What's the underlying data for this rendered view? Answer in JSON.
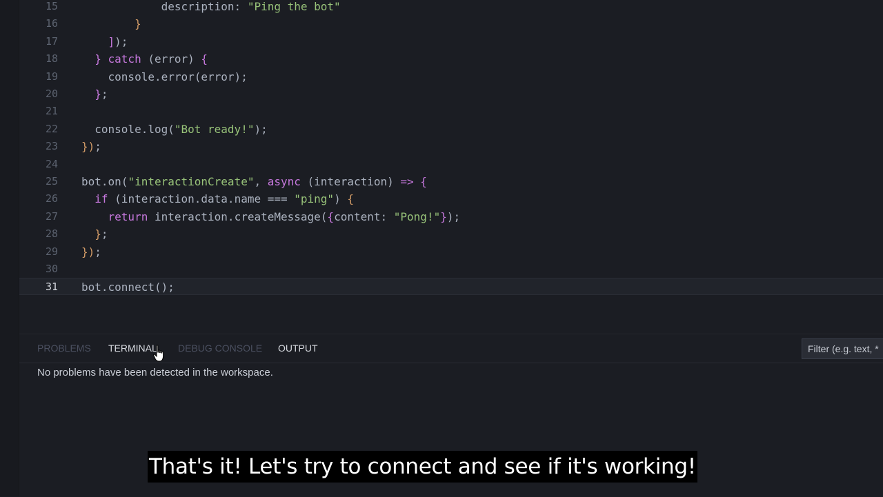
{
  "editor": {
    "lines": [
      {
        "num": "15",
        "indent": "      ",
        "tokens": [
          {
            "t": "description: ",
            "c": "p"
          },
          {
            "t": "\"Ping the bot\"",
            "c": "s"
          }
        ]
      },
      {
        "num": "16",
        "indent": "    ",
        "tokens": [
          {
            "t": "}",
            "c": "b"
          }
        ]
      },
      {
        "num": "17",
        "indent": "  ",
        "tokens": [
          {
            "t": "]",
            "c": "k"
          },
          {
            "t": ");",
            "c": "p"
          }
        ]
      },
      {
        "num": "18",
        "indent": " ",
        "tokens": [
          {
            "t": "} ",
            "c": "k"
          },
          {
            "t": "catch ",
            "c": "k"
          },
          {
            "t": "(error) ",
            "c": "p"
          },
          {
            "t": "{",
            "c": "k"
          }
        ]
      },
      {
        "num": "19",
        "indent": "  ",
        "tokens": [
          {
            "t": "console.error(error);",
            "c": "p"
          }
        ]
      },
      {
        "num": "20",
        "indent": " ",
        "tokens": [
          {
            "t": "}",
            "c": "k"
          },
          {
            "t": ";",
            "c": "p"
          }
        ]
      },
      {
        "num": "21",
        "indent": "",
        "tokens": []
      },
      {
        "num": "22",
        "indent": " ",
        "tokens": [
          {
            "t": "console.log(",
            "c": "p"
          },
          {
            "t": "\"Bot ready!\"",
            "c": "s"
          },
          {
            "t": ");",
            "c": "p"
          }
        ]
      },
      {
        "num": "23",
        "indent": "",
        "tokens": [
          {
            "t": "})",
            "c": "b"
          },
          {
            "t": ";",
            "c": "p"
          }
        ]
      },
      {
        "num": "24",
        "indent": "",
        "tokens": []
      },
      {
        "num": "25",
        "indent": "",
        "tokens": [
          {
            "t": "bot.on(",
            "c": "p"
          },
          {
            "t": "\"interactionCreate\"",
            "c": "s"
          },
          {
            "t": ", ",
            "c": "p"
          },
          {
            "t": "async ",
            "c": "k"
          },
          {
            "t": "(interaction) ",
            "c": "p"
          },
          {
            "t": "=> {",
            "c": "k"
          }
        ]
      },
      {
        "num": "26",
        "indent": " ",
        "tokens": [
          {
            "t": "if ",
            "c": "k"
          },
          {
            "t": "(interaction.data.name === ",
            "c": "p"
          },
          {
            "t": "\"ping\"",
            "c": "s"
          },
          {
            "t": ") ",
            "c": "p"
          },
          {
            "t": "{",
            "c": "b"
          }
        ]
      },
      {
        "num": "27",
        "indent": "  ",
        "tokens": [
          {
            "t": "return ",
            "c": "k"
          },
          {
            "t": "interaction.createMessage(",
            "c": "p"
          },
          {
            "t": "{",
            "c": "k"
          },
          {
            "t": "content: ",
            "c": "p"
          },
          {
            "t": "\"Pong!\"",
            "c": "s"
          },
          {
            "t": "}",
            "c": "k"
          },
          {
            "t": ");",
            "c": "p"
          }
        ]
      },
      {
        "num": "28",
        "indent": " ",
        "tokens": [
          {
            "t": "}",
            "c": "b"
          },
          {
            "t": ";",
            "c": "p"
          }
        ]
      },
      {
        "num": "29",
        "indent": "",
        "tokens": [
          {
            "t": "})",
            "c": "b"
          },
          {
            "t": ";",
            "c": "p"
          }
        ]
      },
      {
        "num": "30",
        "indent": "",
        "tokens": []
      },
      {
        "num": "31",
        "indent": "",
        "tokens": [
          {
            "t": "bot.connect();",
            "c": "p"
          }
        ],
        "current": true
      }
    ]
  },
  "panel": {
    "tabs": {
      "problems": "PROBLEMS",
      "terminal": "TERMINAL",
      "debug_console": "DEBUG CONSOLE",
      "output": "OUTPUT"
    },
    "filter_placeholder": "Filter (e.g. text, *",
    "message": "No problems have been detected in the workspace."
  },
  "subtitle": "That's it! Let's try to connect and see if it's working!",
  "icons": {
    "cursor": "pointer-hand-icon"
  }
}
